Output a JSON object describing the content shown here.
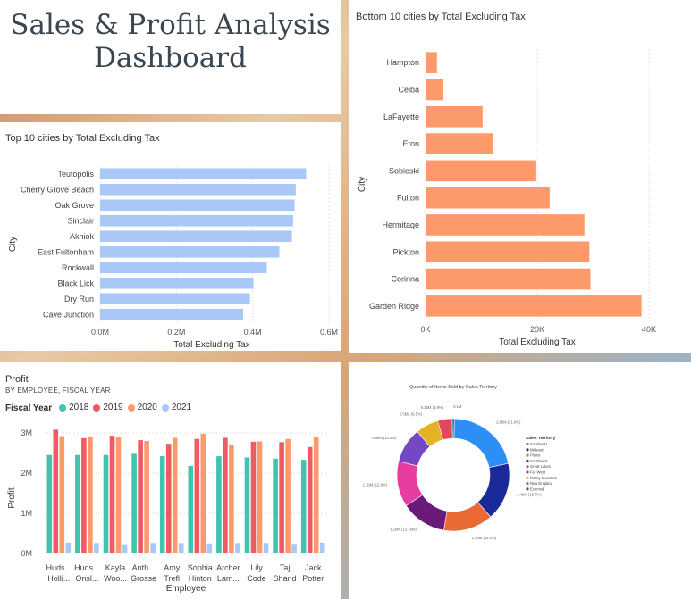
{
  "dashboard": {
    "title": "Sales & Profit Analysis\nDashboard"
  },
  "top10": {
    "chart_data": {
      "type": "bar",
      "orientation": "horizontal",
      "title": "Top 10 cities by Total Excluding Tax",
      "xlabel": "Total Excluding Tax",
      "ylabel": "City",
      "categories": [
        "Teutopolis",
        "Cherry Grove Beach",
        "Oak Grove",
        "Sinclair",
        "Akhiok",
        "East Fultonham",
        "Rockwall",
        "Black Lick",
        "Dry Run",
        "Cave Junction"
      ],
      "values": [
        540000,
        513000,
        510000,
        506000,
        503000,
        470000,
        437000,
        402000,
        393000,
        375000
      ],
      "xlim": [
        0,
        600000
      ],
      "xticks": [
        "0.0M",
        "0.2M",
        "0.4M",
        "0.6M"
      ],
      "color": "#a9c8f8"
    }
  },
  "bottom10": {
    "chart_data": {
      "type": "bar",
      "orientation": "horizontal",
      "title": "Bottom 10 cities by Total Excluding Tax",
      "xlabel": "Total Excluding Tax",
      "ylabel": "City",
      "categories": [
        "Hampton",
        "Ceiba",
        "LaFayette",
        "Eton",
        "Sobieski",
        "Fulton",
        "Hermitage",
        "Pickton",
        "Corinna",
        "Garden Ridge"
      ],
      "values": [
        2300,
        3600,
        11500,
        13500,
        22300,
        25000,
        32000,
        33000,
        33200,
        43500
      ],
      "xlim": [
        0,
        45000
      ],
      "xticks": [
        "0K",
        "20K",
        "40K"
      ],
      "color": "#fd9a6b"
    }
  },
  "profit": {
    "chart_data": {
      "type": "bar",
      "title": "Profit",
      "subtitle": "BY EMPLOYEE, FISCAL YEAR",
      "xlabel": "Employee",
      "ylabel": "Profit",
      "legend_title": "Fiscal Year",
      "categories": [
        "Huds... Holli...",
        "Huds... Onsl...",
        "Kayla Woo...",
        "Anth... Grosse",
        "Amy Trefl",
        "Sophia Hinton",
        "Archer Lam...",
        "Lily Code",
        "Taj Shand",
        "Jack Potter"
      ],
      "series": [
        {
          "name": "2018",
          "color": "#41c4ad",
          "values": [
            2450000,
            2450000,
            2450000,
            2480000,
            2420000,
            2180000,
            2420000,
            2390000,
            2360000,
            2330000
          ]
        },
        {
          "name": "2019",
          "color": "#f05a63",
          "values": [
            3080000,
            2870000,
            2930000,
            2820000,
            2730000,
            2850000,
            2880000,
            2780000,
            2770000,
            2650000
          ]
        },
        {
          "name": "2020",
          "color": "#fd9a6b",
          "values": [
            2920000,
            2890000,
            2900000,
            2800000,
            2880000,
            2980000,
            2690000,
            2790000,
            2850000,
            2890000
          ]
        },
        {
          "name": "2021",
          "color": "#a9c8f8",
          "values": [
            270000,
            260000,
            230000,
            260000,
            260000,
            250000,
            260000,
            260000,
            240000,
            270000
          ]
        }
      ],
      "ylim": [
        0,
        3200000
      ],
      "yticks": [
        "0M",
        "1M",
        "2M",
        "3M"
      ]
    }
  },
  "donut": {
    "chart_data": {
      "type": "pie",
      "hole": true,
      "title": "Quantity of Items Sold by Sales Territory",
      "legend_title": "Sales Territory",
      "slices": [
        {
          "name": "Southeast",
          "value": 1.8,
          "label": "1.8bM (21.6%)",
          "color": "#2d8ff5"
        },
        {
          "name": "Mideast",
          "value": 1.4,
          "label": "1.4bM (15.7%)",
          "color": "#1a2a99"
        },
        {
          "name": "Plains",
          "value": 1.2,
          "label": "1.2bM (14.0%)",
          "color": "#ea6a35"
        },
        {
          "name": "Southwest",
          "value": 1.1,
          "label": "1.1bM (13.1bM)",
          "color": "#6b1a7a"
        },
        {
          "name": "Great Lakes",
          "value": 1.1,
          "label": "1.1bM (12.9%)",
          "color": "#e53ea0"
        },
        {
          "name": "Far West",
          "value": 0.85,
          "label": "0.9bM (10.4%)",
          "color": "#7447c3"
        },
        {
          "name": "Rocky Mountain",
          "value": 0.55,
          "label": "0.5bM (6.5%)",
          "color": "#e3b324"
        },
        {
          "name": "New England",
          "value": 0.35,
          "label": "0.3bM (3.9%)",
          "color": "#e1475d"
        },
        {
          "name": "External",
          "value": 0.05,
          "label": "0.1M",
          "color": "#1a6a8a"
        }
      ]
    }
  }
}
